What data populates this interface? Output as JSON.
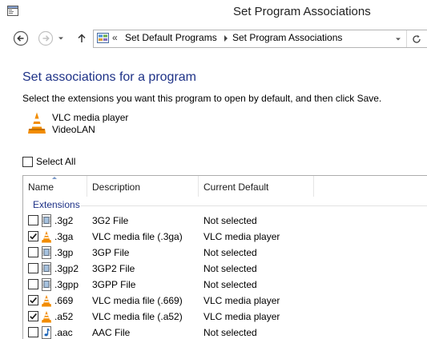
{
  "window": {
    "title": "Set Program Associations"
  },
  "breadcrumb": {
    "overflow": "«",
    "items": [
      "Set Default Programs",
      "Set Program Associations"
    ]
  },
  "main": {
    "heading": "Set associations for a program",
    "instructions": "Select the extensions you want this program to open by default, and then click Save.",
    "program": {
      "name": "VLC media player",
      "vendor": "VideoLAN"
    },
    "select_all": {
      "label": "Select All",
      "checked": false
    }
  },
  "list": {
    "columns": [
      "Name",
      "Description",
      "Current Default"
    ],
    "sort_column": "Name",
    "group": "Extensions",
    "rows": [
      {
        "ext": ".3g2",
        "desc": "3G2 File",
        "default": "Not selected",
        "checked": false,
        "icon": "media-file-icon"
      },
      {
        "ext": ".3ga",
        "desc": "VLC media file (.3ga)",
        "default": "VLC media player",
        "checked": true,
        "icon": "vlc-cone-icon"
      },
      {
        "ext": ".3gp",
        "desc": "3GP File",
        "default": "Not selected",
        "checked": false,
        "icon": "media-file-icon"
      },
      {
        "ext": ".3gp2",
        "desc": "3GP2 File",
        "default": "Not selected",
        "checked": false,
        "icon": "media-file-icon"
      },
      {
        "ext": ".3gpp",
        "desc": "3GPP File",
        "default": "Not selected",
        "checked": false,
        "icon": "media-file-icon"
      },
      {
        "ext": ".669",
        "desc": "VLC media file (.669)",
        "default": "VLC media player",
        "checked": true,
        "icon": "vlc-cone-icon"
      },
      {
        "ext": ".a52",
        "desc": "VLC media file (.a52)",
        "default": "VLC media player",
        "checked": true,
        "icon": "vlc-cone-icon"
      },
      {
        "ext": ".aac",
        "desc": "AAC File",
        "default": "Not selected",
        "checked": false,
        "icon": "audio-file-icon"
      }
    ]
  },
  "colors": {
    "heading": "#1e3287",
    "vlc_orange": "#f28c00",
    "border": "#adadad"
  }
}
